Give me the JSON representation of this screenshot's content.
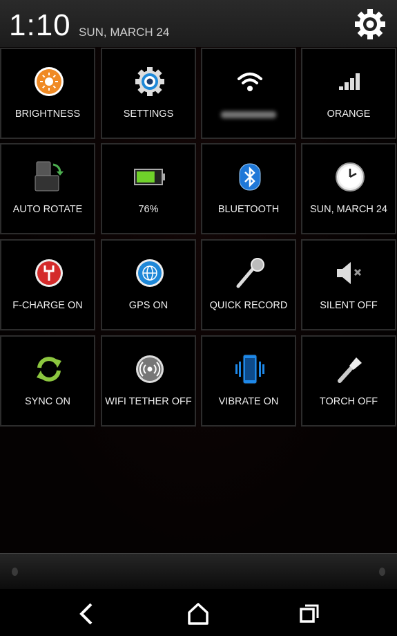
{
  "header": {
    "time": "1:10",
    "date": "SUN, MARCH 24",
    "settings_icon": "gear-icon"
  },
  "tiles": [
    {
      "label": "BRIGHTNESS",
      "icon": "brightness-icon"
    },
    {
      "label": "SETTINGS",
      "icon": "settings-icon"
    },
    {
      "label": "",
      "icon": "wifi-icon",
      "blurred": true
    },
    {
      "label": "ORANGE",
      "icon": "signal-icon"
    },
    {
      "label": "AUTO ROTATE",
      "icon": "rotate-icon"
    },
    {
      "label": "76%",
      "icon": "battery-icon",
      "level": 76
    },
    {
      "label": "BLUETOOTH",
      "icon": "bluetooth-icon"
    },
    {
      "label": "SUN, MARCH 24",
      "icon": "clock-icon"
    },
    {
      "label": "F-CHARGE ON",
      "icon": "fast-charge-icon"
    },
    {
      "label": "GPS ON",
      "icon": "gps-icon"
    },
    {
      "label": "QUICK RECORD",
      "icon": "microphone-icon"
    },
    {
      "label": "SILENT OFF",
      "icon": "speaker-mute-icon"
    },
    {
      "label": "SYNC ON",
      "icon": "sync-icon"
    },
    {
      "label": "WIFI TETHER OFF",
      "icon": "wifi-tether-icon"
    },
    {
      "label": "VIBRATE ON",
      "icon": "vibrate-icon"
    },
    {
      "label": "TORCH OFF",
      "icon": "torch-icon"
    }
  ],
  "nav": {
    "back": "back-icon",
    "home": "home-icon",
    "recents": "recents-icon"
  },
  "colors": {
    "brightness": "#f08a24",
    "settings": "#1e88d8",
    "battery": "#6fd12a",
    "bluetooth": "#1f78d8",
    "fcharge": "#d42a2a",
    "gps": "#1e88d8",
    "sync": "#8cc63f",
    "vibrate": "#1e88e8"
  }
}
